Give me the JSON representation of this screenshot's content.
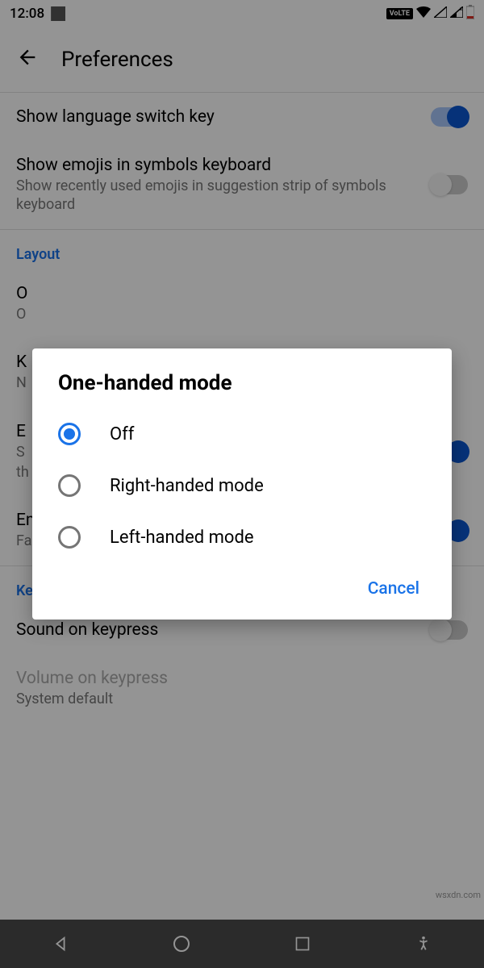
{
  "status": {
    "time": "12:08",
    "volte": "VoLTE"
  },
  "header": {
    "title": "Preferences"
  },
  "settings": {
    "langSwitch": {
      "title": "Show language switch key"
    },
    "emojisSymbols": {
      "title": "Show emojis in symbols keyboard",
      "subtitle": "Show recently used emojis in suggestion strip of symbols keyboard"
    },
    "oneHanded": {
      "title": "O",
      "subtitle": "O"
    },
    "keyboardHeight": {
      "title": "K",
      "subtitle": "N"
    },
    "emojiFastbar": {
      "title": "Emoji fast-access bar",
      "subtitle": "Fast access bar on the typing keyboard for popular emojis."
    },
    "soundKeypress": {
      "title": "Sound on keypress"
    },
    "volumeKeypress": {
      "title": "Volume on keypress",
      "subtitle": "System default"
    },
    "expressive": {
      "title": "E",
      "subtitle1": "S",
      "subtitle2": "th"
    }
  },
  "sections": {
    "layout": "Layout",
    "keypress": "Key press"
  },
  "dialog": {
    "title": "One-handed mode",
    "options": [
      "Off",
      "Right-handed mode",
      "Left-handed mode"
    ],
    "selectedIndex": 0,
    "cancel": "Cancel"
  },
  "watermark": "wsxdn.com"
}
